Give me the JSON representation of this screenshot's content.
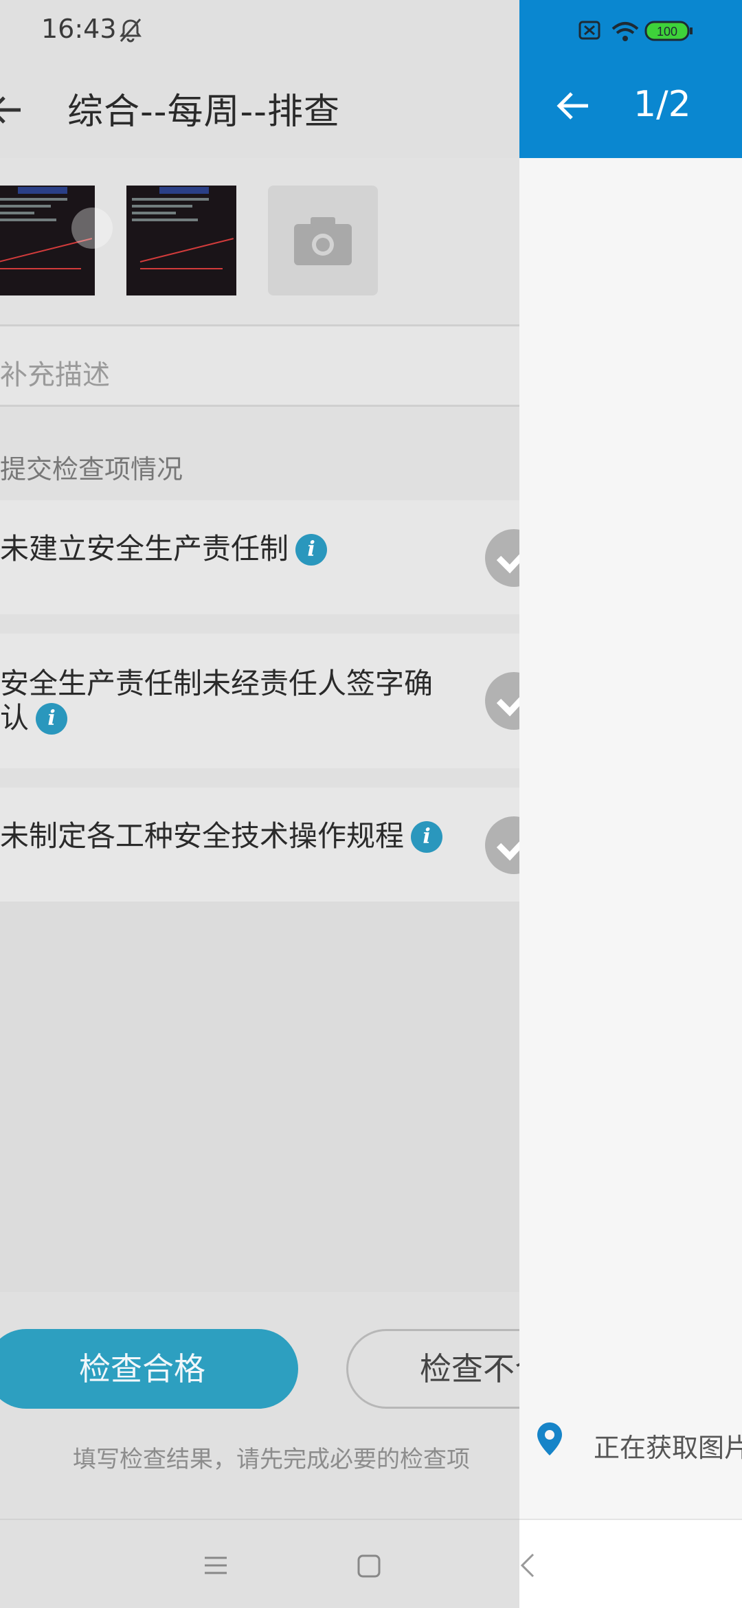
{
  "status_bar": {
    "time": "16:43",
    "battery": "100"
  },
  "screen": {
    "title": "综合--每周--排查",
    "description_placeholder": "补充描述",
    "section_label": "提交检查项情况",
    "items": [
      {
        "text": "未建立安全生产责任制"
      },
      {
        "text_line1": "安全生产责任制未经责任人签字确",
        "text_line2": "认"
      },
      {
        "text": "未制定各工种安全技术操作规程"
      }
    ],
    "info_glyph": "i",
    "pass_button": "检查合格",
    "fail_button": "检查不合格",
    "hint": "填写检查结果，请先完成必要的检查项"
  },
  "viewer": {
    "counter": "1/2",
    "location_text": "正在获取图片地址..."
  },
  "colors": {
    "accent": "#2d9fc0",
    "viewer_header": "#0a87d0"
  }
}
